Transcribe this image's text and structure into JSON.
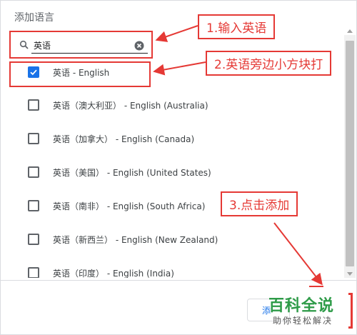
{
  "dialog": {
    "title": "添加语言",
    "search": {
      "value": "英语",
      "icon": "search-icon",
      "clear_icon": "clear-icon"
    },
    "languages": [
      {
        "label": "英语 - English",
        "checked": true
      },
      {
        "label": "英语（澳大利亚） - English (Australia)",
        "checked": false
      },
      {
        "label": "英语（加拿大） - English (Canada)",
        "checked": false
      },
      {
        "label": "英语（美国） - English (United States)",
        "checked": false
      },
      {
        "label": "英语（南非） - English (South Africa)",
        "checked": false
      },
      {
        "label": "英语（新西兰） - English (New Zealand)",
        "checked": false
      },
      {
        "label": "英语（印度） - English (India)",
        "checked": false
      }
    ],
    "add_button_label": "添"
  },
  "annotations": {
    "step1": "1.输入英语",
    "step2": "2.英语旁边小方块打",
    "step3": "3.点击添加",
    "color": "#e53935"
  },
  "watermark": {
    "main": "百科全说",
    "sub": "助你轻松解决",
    "color": "#2e9b48"
  },
  "colors": {
    "accent": "#1a73e8"
  }
}
